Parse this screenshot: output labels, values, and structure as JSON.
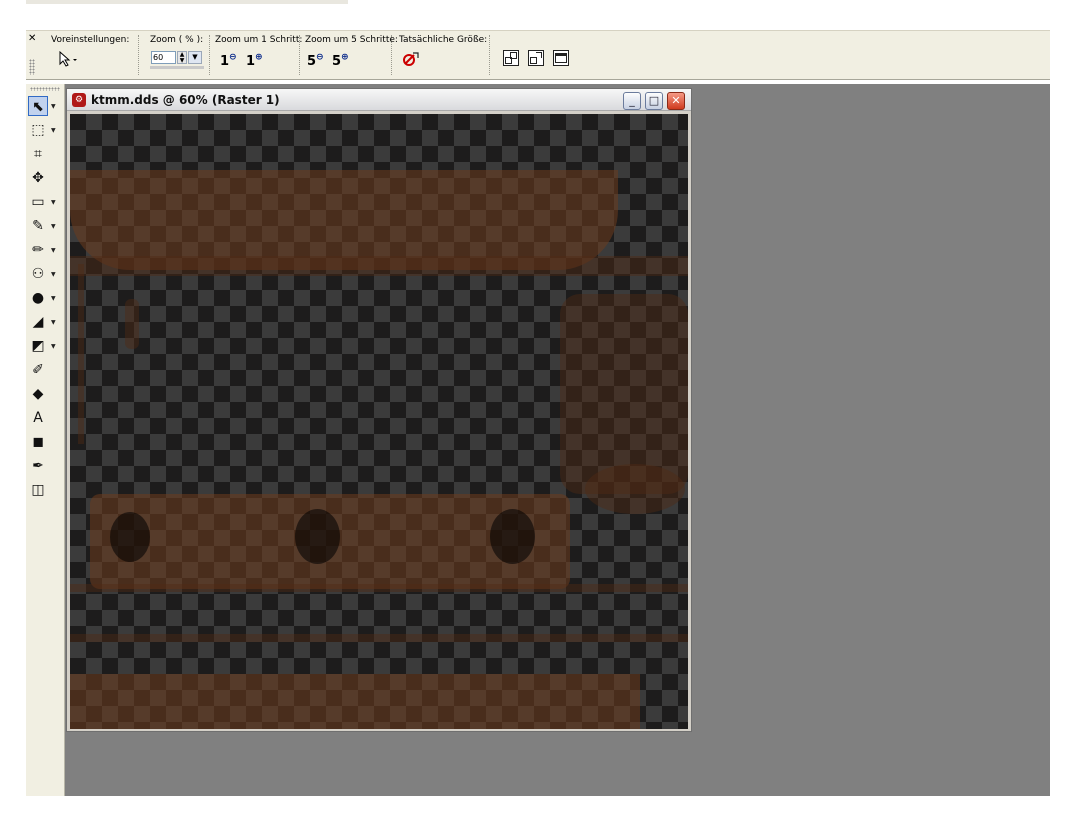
{
  "toolbar": {
    "close_glyph": "✕",
    "groups": [
      {
        "label": "Voreinstellungen:"
      },
      {
        "label": "Zoom ( % ):"
      },
      {
        "label": "Zoom um 1 Schritt:"
      },
      {
        "label": "Zoom um 5 Schritte:"
      },
      {
        "label": "Tatsächliche Größe:"
      }
    ],
    "zoom_value": "60",
    "step1_out_label": "1",
    "step1_in_label": "1",
    "step5_out_label": "5",
    "step5_in_label": "5"
  },
  "toolbox": {
    "tools": [
      {
        "icon": "pick-arrow-icon",
        "glyph": "⬉"
      },
      {
        "icon": "selection-icon",
        "glyph": "⬚"
      },
      {
        "icon": "crop-icon",
        "glyph": "⌗"
      },
      {
        "icon": "move-icon",
        "glyph": "✥"
      },
      {
        "icon": "rect-select-icon",
        "glyph": "▭"
      },
      {
        "icon": "dropper-icon",
        "glyph": "✎"
      },
      {
        "icon": "paint-brush-icon",
        "glyph": "✏"
      },
      {
        "icon": "clone-icon",
        "glyph": "⚇"
      },
      {
        "icon": "zoom-tool-icon",
        "glyph": "●"
      },
      {
        "icon": "dodge-icon",
        "glyph": "◢"
      },
      {
        "icon": "color-replace-icon",
        "glyph": "◩"
      },
      {
        "icon": "eraser-icon",
        "glyph": "✐"
      },
      {
        "icon": "fill-icon",
        "glyph": "◆"
      },
      {
        "icon": "text-tool-icon",
        "glyph": "A"
      },
      {
        "icon": "shape-tool-icon",
        "glyph": "◼"
      },
      {
        "icon": "pen-tool-icon",
        "glyph": "✒"
      },
      {
        "icon": "warp-icon",
        "glyph": "◫"
      }
    ]
  },
  "document": {
    "title": "ktmm.dds @  60% (Raster 1)",
    "minimize": "_",
    "maximize": "□",
    "close": "✕"
  },
  "colors": {
    "toolbar_bg": "#f1efe2",
    "workspace_bg": "#808080",
    "texture_brown": "#6e3c1e"
  }
}
